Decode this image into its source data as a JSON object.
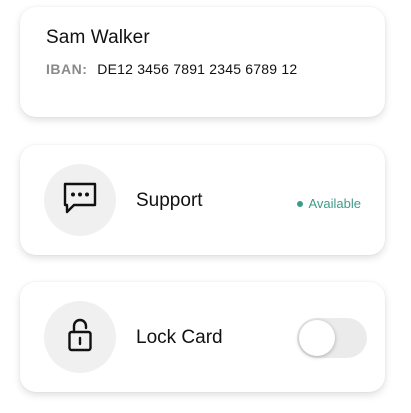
{
  "account": {
    "holder_name": "Sam Walker",
    "iban_label": "IBAN:",
    "iban_value": "DE12 3456 7891 2345 6789 12"
  },
  "support": {
    "label": "Support",
    "status": "Available",
    "status_color": "#3d9c88",
    "icon": "chat-bubble-icon"
  },
  "lock_card": {
    "label": "Lock Card",
    "icon": "padlock-icon",
    "toggle_on": false
  }
}
